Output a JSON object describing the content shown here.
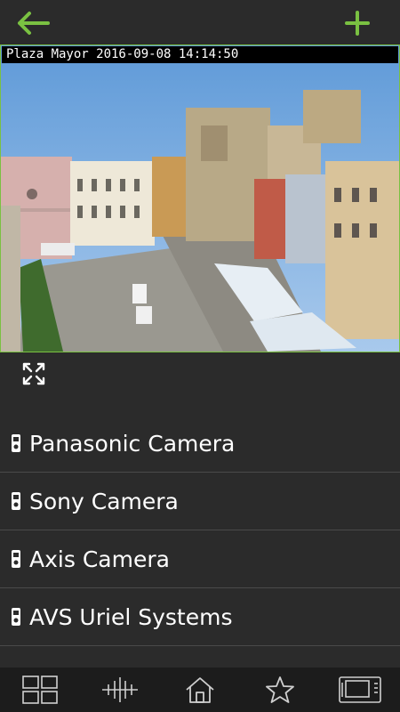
{
  "header": {
    "back_icon": "arrow-left-icon",
    "add_icon": "plus-icon",
    "accent_color": "#7ac142"
  },
  "camera": {
    "overlay_text": "Plaza Mayor 2016-09-08 14:14:50",
    "border_color": "#7ac142",
    "fullscreen_icon": "expand-icon"
  },
  "devices": [
    {
      "label": "Panasonic Camera",
      "icon": "intercom-device-icon"
    },
    {
      "label": "Sony Camera",
      "icon": "intercom-device-icon"
    },
    {
      "label": "Axis Camera",
      "icon": "intercom-device-icon"
    },
    {
      "label": "AVS Uriel Systems",
      "icon": "intercom-device-icon"
    }
  ],
  "bottom_nav": [
    {
      "icon": "grid-icon"
    },
    {
      "icon": "sliders-icon"
    },
    {
      "icon": "home-icon"
    },
    {
      "icon": "star-icon"
    },
    {
      "icon": "video-intercom-icon"
    }
  ]
}
